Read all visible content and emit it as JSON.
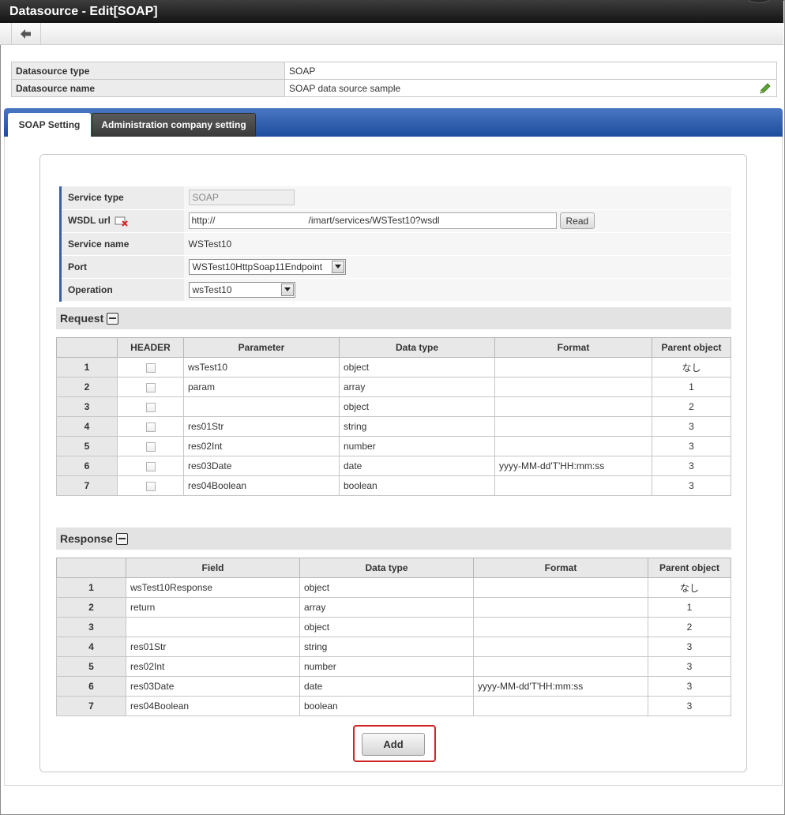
{
  "window": {
    "title": "Datasource - Edit[SOAP]"
  },
  "toolbar": {
    "back_icon": "arrow-left-icon"
  },
  "info": {
    "type_label": "Datasource type",
    "type_value": "SOAP",
    "name_label": "Datasource name",
    "name_value": "SOAP data source sample",
    "edit_icon": "pencil-icon"
  },
  "tabs": [
    {
      "label": "SOAP Setting",
      "active": true
    },
    {
      "label": "Administration company setting",
      "active": false
    }
  ],
  "settings": {
    "service_type_label": "Service type",
    "service_type_value": "SOAP",
    "wsdl_label": "WSDL url",
    "wsdl_prefix": "http://",
    "wsdl_suffix": "/imart/services/WSTest10?wsdl",
    "read_label": "Read",
    "service_name_label": "Service name",
    "service_name_value": "WSTest10",
    "port_label": "Port",
    "port_value": "WSTest10HttpSoap11Endpoint",
    "operation_label": "Operation",
    "operation_value": "wsTest10"
  },
  "request": {
    "title": "Request",
    "headers": [
      "",
      "HEADER",
      "Parameter",
      "Data type",
      "Format",
      "Parent object"
    ],
    "rows": [
      {
        "no": "1",
        "param": "wsTest10",
        "type": "object",
        "format": "",
        "parent": "なし"
      },
      {
        "no": "2",
        "param": "param",
        "type": "array",
        "format": "",
        "parent": "1"
      },
      {
        "no": "3",
        "param": "",
        "type": "object",
        "format": "",
        "parent": "2"
      },
      {
        "no": "4",
        "param": "res01Str",
        "type": "string",
        "format": "",
        "parent": "3"
      },
      {
        "no": "5",
        "param": "res02Int",
        "type": "number",
        "format": "",
        "parent": "3"
      },
      {
        "no": "6",
        "param": "res03Date",
        "type": "date",
        "format": "yyyy-MM-dd'T'HH:mm:ss",
        "parent": "3"
      },
      {
        "no": "7",
        "param": "res04Boolean",
        "type": "boolean",
        "format": "",
        "parent": "3"
      }
    ]
  },
  "response": {
    "title": "Response",
    "headers": [
      "",
      "Field",
      "Data type",
      "Format",
      "Parent object"
    ],
    "rows": [
      {
        "no": "1",
        "field": "wsTest10Response",
        "type": "object",
        "format": "",
        "parent": "なし"
      },
      {
        "no": "2",
        "field": "return",
        "type": "array",
        "format": "",
        "parent": "1"
      },
      {
        "no": "3",
        "field": "",
        "type": "object",
        "format": "",
        "parent": "2"
      },
      {
        "no": "4",
        "field": "res01Str",
        "type": "string",
        "format": "",
        "parent": "3"
      },
      {
        "no": "5",
        "field": "res02Int",
        "type": "number",
        "format": "",
        "parent": "3"
      },
      {
        "no": "6",
        "field": "res03Date",
        "type": "date",
        "format": "yyyy-MM-dd'T'HH:mm:ss",
        "parent": "3"
      },
      {
        "no": "7",
        "field": "res04Boolean",
        "type": "boolean",
        "format": "",
        "parent": "3"
      }
    ]
  },
  "actions": {
    "add_label": "Add"
  },
  "colors": {
    "tab_bar": "#2a5aa8",
    "highlight": "#d22222"
  }
}
